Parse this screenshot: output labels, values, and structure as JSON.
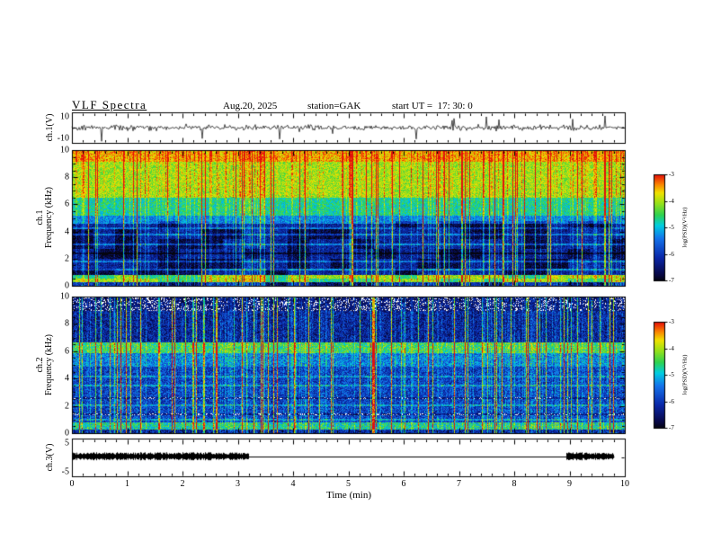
{
  "figure": {
    "title": "VLF Spectra",
    "date": "Aug.20, 2025",
    "station": "station=GAK",
    "start_ut": "start UT =  17: 30: 0",
    "xlabel": "Time (min)",
    "x_ticks": [
      0,
      1,
      2,
      3,
      4,
      5,
      6,
      7,
      8,
      9,
      10
    ]
  },
  "panels": {
    "wave": {
      "ylabel": "ch.1(V)",
      "y_ticks": [
        10,
        -10
      ],
      "ylim": [
        -10,
        10
      ]
    },
    "sp1": {
      "ylabel_ch": "ch.1",
      "ylabel_freq": "Frequency (kHz)",
      "y_ticks": [
        0,
        2,
        4,
        6,
        8,
        10
      ],
      "ylim": [
        0,
        10
      ]
    },
    "sp2": {
      "ylabel_ch": "ch.2",
      "ylabel_freq": "Frequency (kHz)",
      "y_ticks": [
        0,
        2,
        4,
        6,
        8,
        10
      ],
      "ylim": [
        0,
        10
      ]
    },
    "ch3": {
      "ylabel": "ch.3(V)",
      "y_ticks": [
        5,
        -5
      ],
      "ylim": [
        -5,
        5
      ]
    }
  },
  "colorbar": {
    "label": "log(PSD)(V²/Hz)",
    "ticks": [
      -3,
      -4,
      -5,
      -6,
      -7
    ],
    "range": [
      -7,
      -3
    ]
  },
  "chart_data": [
    {
      "type": "line",
      "panel": "ch1_waveform",
      "ylabel": "ch.1(V)",
      "ylim": [
        -10,
        10
      ],
      "xlim": [
        0,
        10
      ],
      "x_unit": "min",
      "description": "Raw VLF receiver waveform: broadband noise of roughly ±2 V about 0 V with frequent impulsive sferic spikes reaching about ±9 V across the whole 10-minute record."
    },
    {
      "type": "heatmap",
      "panel": "ch1_spectrogram",
      "ylabel": "Frequency (kHz)",
      "ylim": [
        0,
        10
      ],
      "xlim": [
        0,
        10
      ],
      "x_unit": "min",
      "value_label": "log(PSD)(V²/Hz)",
      "value_range": [
        -7,
        -3
      ],
      "features": [
        "intense broadband emission (yellow-orange-red, PSD about -4 to -3) above ~6.5 kHz for the whole record",
        "dense vertical sferic streaks spanning 0-10 kHz, many reaching red at the top of the band",
        "green-cyan transition band between ~5 and 6.5 kHz",
        "blue / dark-blue background (PSD about -6 to -7) below ~5 kHz with black patches",
        "several narrow horizontal interference lines between 1 and 4.5 kHz",
        "bright narrowband emission line near 0.5 kHz (green-yellow-red)"
      ]
    },
    {
      "type": "heatmap",
      "panel": "ch2_spectrogram",
      "ylabel": "Frequency (kHz)",
      "ylim": [
        0,
        10
      ],
      "xlim": [
        0,
        10
      ],
      "x_unit": "min",
      "value_label": "log(PSD)(V²/Hz)",
      "value_range": [
        -7,
        -3
      ],
      "features": [
        "much weaker channel: speckled white/blue background (PSD near or below -6.5) above ~6.7 kHz",
        "prominent yellow-green narrowband line near 6 kHz for the whole record",
        "blue noisy background with horizontal interference lines below ~5 kHz",
        "frequent vertical broadband streaks; strongest (orange-red) near t = 5.4 min",
        "bright narrowband line near 0.5 kHz"
      ]
    },
    {
      "type": "line",
      "panel": "ch3_status",
      "ylabel": "ch.3(V)",
      "ylim": [
        -5,
        5
      ],
      "xlim": [
        0,
        10
      ],
      "x_unit": "min",
      "segments": [
        {
          "t": [
            0,
            3.2
          ],
          "description": "dense black pulse band around +0.3 V (about ±0.8 V thick)"
        },
        {
          "t": [
            3.2,
            8.95
          ],
          "description": "thin flat line at about +0.3 V"
        },
        {
          "t": [
            8.95,
            9.8
          ],
          "description": "dense black pulse band around +0.3 V (about ±0.8 V thick)"
        }
      ]
    }
  ]
}
